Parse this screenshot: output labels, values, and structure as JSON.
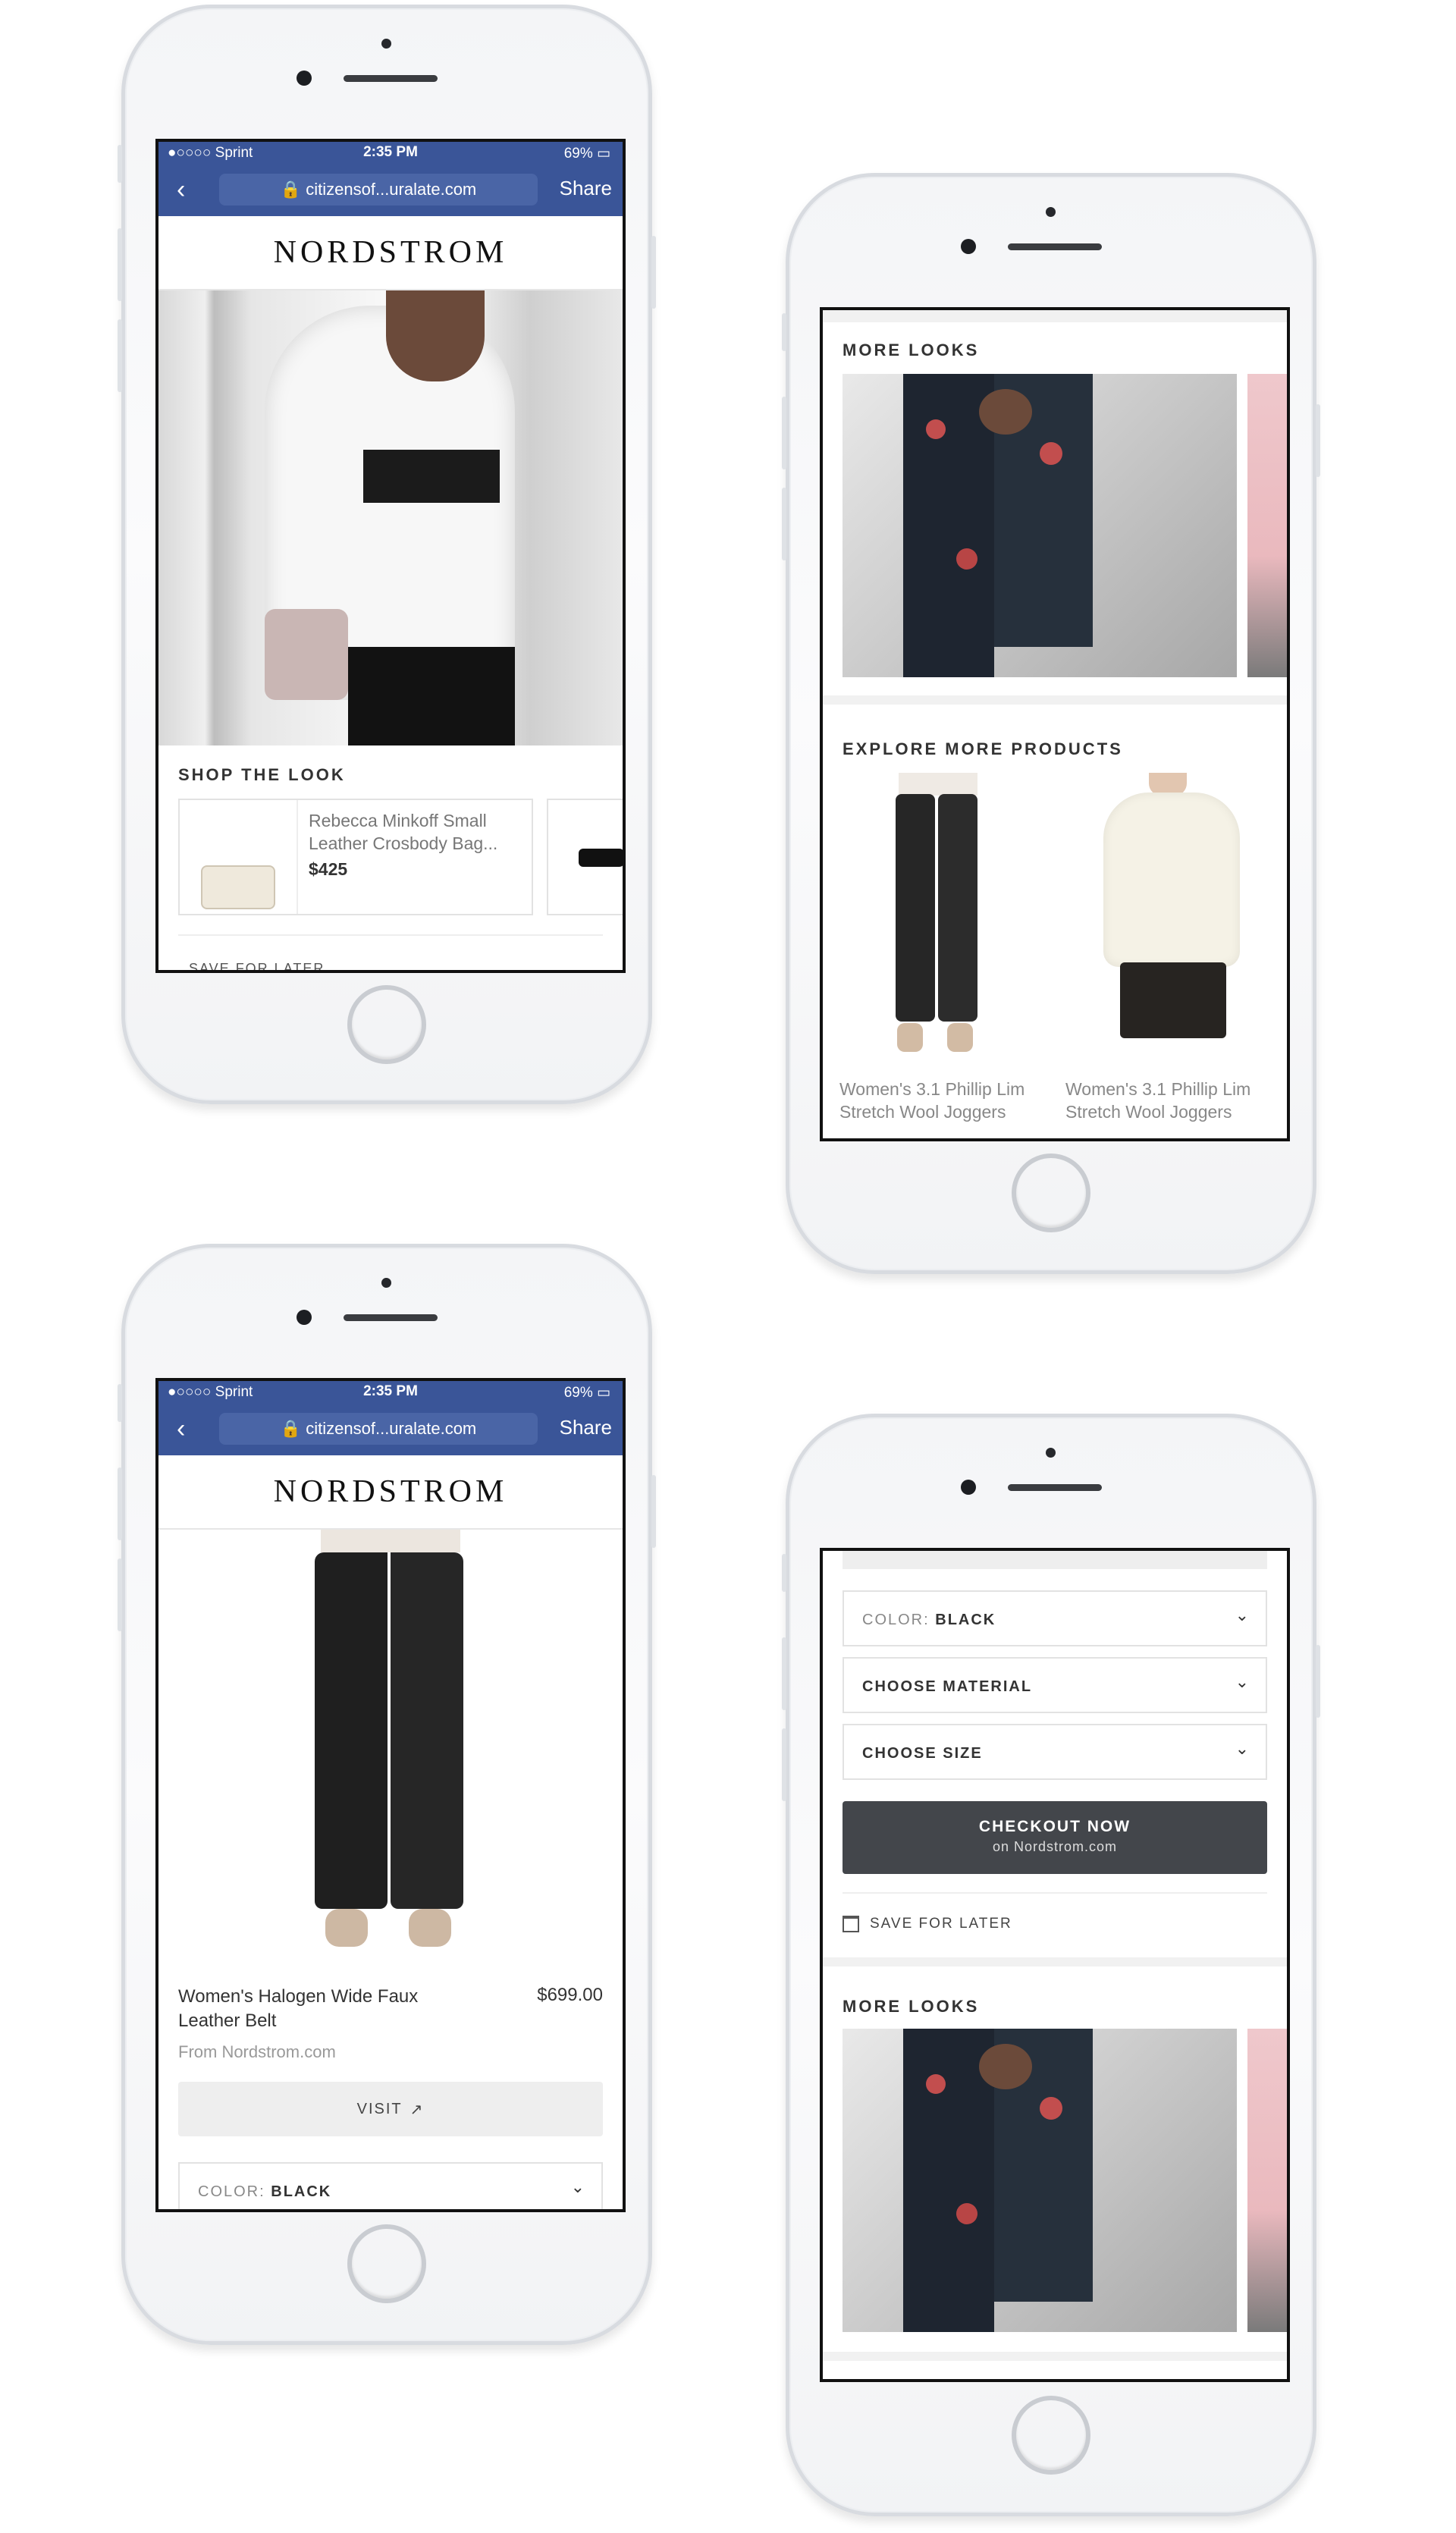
{
  "status": {
    "carrier": "●○○○○ Sprint",
    "time": "2:35 PM",
    "battery": "69%"
  },
  "safari": {
    "url": "citizensof...uralate.com",
    "share_label": "Share"
  },
  "brand": "NORDSTROM",
  "phone1": {
    "section_title": "SHOP THE LOOK",
    "product": {
      "name_line1": "Rebecca Minkoff Small",
      "name_line2": "Leather Crosbody Bag...",
      "price": "$425"
    },
    "cut_label": "SAVE FOR LATER"
  },
  "phone2": {
    "more_looks_title": "MORE LOOKS",
    "explore_title": "EXPLORE MORE PRODUCTS",
    "products": [
      {
        "line1": "Women's 3.1 Phillip Lim",
        "line2": "Stretch Wool Joggers"
      },
      {
        "line1": "Women's 3.1 Phillip Lim",
        "line2": "Stretch Wool Joggers"
      }
    ]
  },
  "phone3": {
    "product_name_line1": "Women's Halogen Wide Faux",
    "product_name_line2": "Leather Belt",
    "price": "$699.00",
    "source": "From Nordstrom.com",
    "visit_label": "VISIT",
    "color_label": "COLOR:",
    "color_value": "BLACK"
  },
  "phone4": {
    "color_label": "COLOR:",
    "color_value": "BLACK",
    "material_label": "CHOOSE MATERIAL",
    "size_label": "CHOOSE SIZE",
    "checkout_label": "CHECKOUT NOW",
    "checkout_sub": "on Nordstrom.com",
    "save_label": "SAVE FOR LATER",
    "more_looks_title": "MORE LOOKS"
  },
  "icons": {
    "chevron": "chevron-down-icon",
    "external": "external-link-icon",
    "save": "save-icon"
  },
  "colors": {
    "safari_blue": "#3a5598",
    "checkout_bg": "#43464b"
  }
}
